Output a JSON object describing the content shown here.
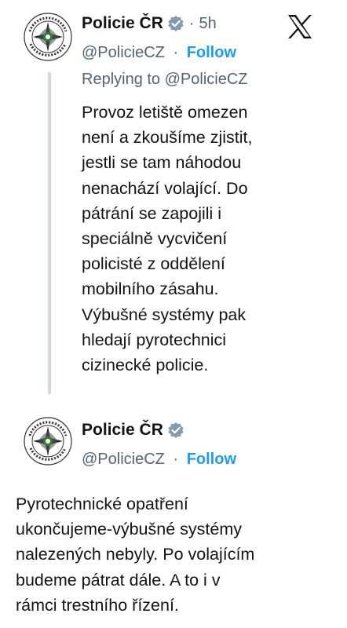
{
  "tweet1": {
    "name": "Policie ČR",
    "time": "5h",
    "separator": "·",
    "handle": "@PolicieCZ",
    "follow": "Follow",
    "replying_prefix": "Replying to",
    "replying_mention": "@PolicieCZ",
    "text": "Provoz letiště omezen\nnení a zkoušíme zjistit,\njestli se tam náhodou\nnenachází volající. Do\npátrání se zapojili i\nspeciálně vycvičení\npolicisté z oddělení\nmobilního zásahu.\nVýbušné systémy pak\nhledají pyrotechnici\ncizinecké policie."
  },
  "tweet2": {
    "name": "Policie ČR",
    "separator": "·",
    "handle": "@PolicieCZ",
    "follow": "Follow",
    "text": "Pyrotechnické opatření\nukončujeme-výbušné systémy\nnalezených nebyly. Po volajícím\nbudeme pátrat dále. A to i v\nrámci trestního řízení."
  },
  "avatar_seal_text": "POLICIE ČESKÉ REPUBLIKY",
  "icons": {
    "brand": "x-logo-icon",
    "verified": "verified-badge-icon"
  },
  "colors": {
    "follow": "#1d9bf0",
    "verified": "#829aab",
    "secondary_text": "#536471",
    "thread_line": "#cfd9de"
  }
}
